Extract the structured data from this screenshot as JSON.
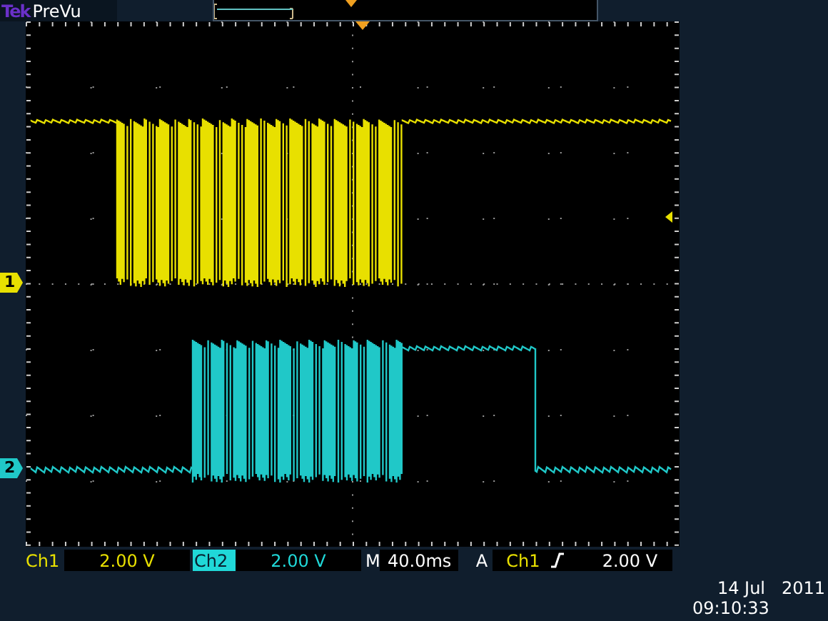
{
  "header": {
    "brand": "Tek",
    "mode": "PreVu"
  },
  "markers": [
    {
      "label": "1",
      "color": "#e8e000"
    },
    {
      "label": "2",
      "color": "#20c8c8"
    }
  ],
  "status_bar": {
    "channels": [
      {
        "label": "Ch1",
        "scale": "2.00 V",
        "color": "#e8e000",
        "selected": false
      },
      {
        "label": "Ch2",
        "scale": "2.00 V",
        "color": "#20d8d8",
        "selected": true
      }
    ],
    "timebase": {
      "prefix": "M",
      "value": "40.0ms"
    },
    "trigger": {
      "prefix": "A",
      "source": "Ch1",
      "level": "2.00 V"
    }
  },
  "timestamp": {
    "date": "14 Jul   2011",
    "time": "09:10:33"
  }
}
